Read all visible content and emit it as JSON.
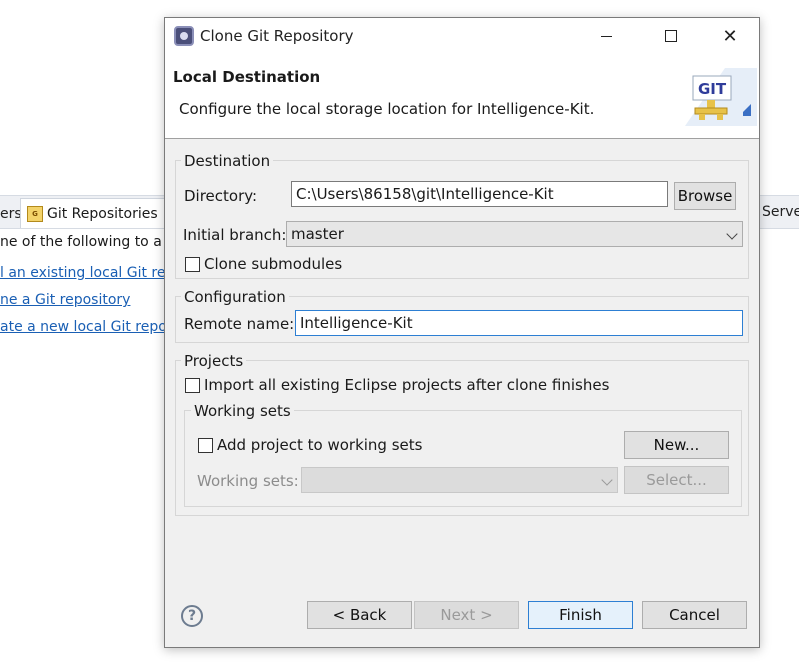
{
  "background": {
    "tab_left_text": "ers",
    "tab_active_label": "Git Repositories",
    "tab_right_text": "Serve",
    "instruction_text": "ne of the following to a",
    "links": [
      "l an existing local Git re",
      "ne a Git repository",
      "ate a new local Git repo"
    ]
  },
  "dialog": {
    "title": "Clone Git Repository",
    "header_title": "Local Destination",
    "header_description": "Configure the local storage location for Intelligence-Kit.",
    "logo_text": "GIT",
    "destination": {
      "group_label": "Destination",
      "directory_label": "Directory:",
      "directory_value": "C:\\Users\\86158\\git\\Intelligence-Kit",
      "browse_label": "Browse",
      "initial_branch_label": "Initial branch:",
      "initial_branch_value": "master",
      "clone_submodules_label": "Clone submodules",
      "clone_submodules_checked": false
    },
    "configuration": {
      "group_label": "Configuration",
      "remote_name_label": "Remote name:",
      "remote_name_value": "Intelligence-Kit"
    },
    "projects": {
      "group_label": "Projects",
      "import_label": "Import all existing Eclipse projects after clone finishes",
      "import_checked": false,
      "working_sets_group_label": "Working sets",
      "add_to_working_sets_label": "Add project to working sets",
      "add_to_working_sets_checked": false,
      "new_button_label": "New...",
      "working_sets_label": "Working sets:",
      "working_sets_value": "",
      "select_button_label": "Select..."
    },
    "footer": {
      "help_symbol": "?",
      "back_label": "< Back",
      "next_label": "Next >",
      "finish_label": "Finish",
      "cancel_label": "Cancel"
    }
  }
}
